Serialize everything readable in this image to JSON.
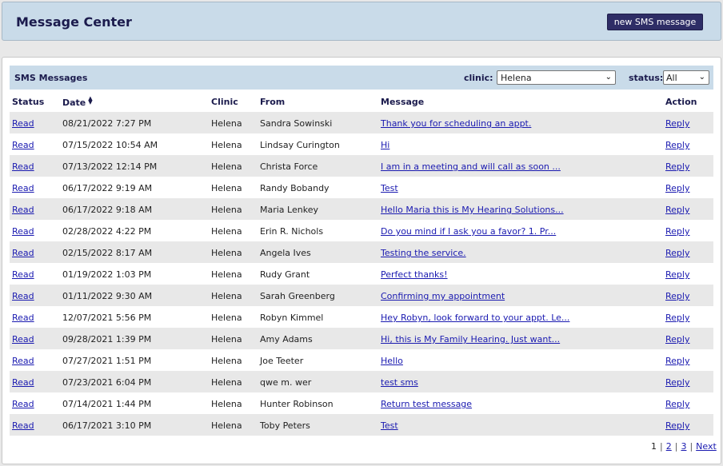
{
  "header": {
    "title": "Message Center",
    "new_button": "new SMS message"
  },
  "panel": {
    "title": "SMS Messages",
    "clinic_label": "clinic:",
    "clinic_value": "Helena",
    "status_label": "status:",
    "status_value": "All"
  },
  "columns": {
    "status": "Status",
    "date": "Date",
    "clinic": "Clinic",
    "from": "From",
    "message": "Message",
    "action": "Action"
  },
  "rows": [
    {
      "status": "Read",
      "date": "08/21/2022 7:27 PM",
      "clinic": "Helena",
      "from": "Sandra Sowinski",
      "message": "Thank you for scheduling an appt.",
      "action": "Reply"
    },
    {
      "status": "Read",
      "date": "07/15/2022 10:54 AM",
      "clinic": "Helena",
      "from": "Lindsay Curington",
      "message": "Hi",
      "action": "Reply"
    },
    {
      "status": "Read",
      "date": "07/13/2022 12:14 PM",
      "clinic": "Helena",
      "from": "Christa Force",
      "message": "I am in a meeting and will call as soon ...",
      "action": "Reply"
    },
    {
      "status": "Read",
      "date": "06/17/2022 9:19 AM",
      "clinic": "Helena",
      "from": "Randy Bobandy",
      "message": "Test",
      "action": "Reply"
    },
    {
      "status": "Read",
      "date": "06/17/2022 9:18 AM",
      "clinic": "Helena",
      "from": "Maria Lenkey",
      "message": "Hello Maria this is My Hearing Solutions...",
      "action": "Reply"
    },
    {
      "status": "Read",
      "date": "02/28/2022 4:22 PM",
      "clinic": "Helena",
      "from": "Erin R. Nichols",
      "message": "Do you mind if I ask you a favor? 1. Pr...",
      "action": "Reply"
    },
    {
      "status": "Read",
      "date": "02/15/2022 8:17 AM",
      "clinic": "Helena",
      "from": "Angela Ives",
      "message": "Testing the service.",
      "action": "Reply"
    },
    {
      "status": "Read",
      "date": "01/19/2022 1:03 PM",
      "clinic": "Helena",
      "from": "Rudy Grant",
      "message": "Perfect thanks!",
      "action": "Reply"
    },
    {
      "status": "Read",
      "date": "01/11/2022 9:30 AM",
      "clinic": "Helena",
      "from": "Sarah Greenberg",
      "message": "Confirming my appointment",
      "action": "Reply"
    },
    {
      "status": "Read",
      "date": "12/07/2021 5:56 PM",
      "clinic": "Helena",
      "from": "Robyn Kimmel",
      "message": "Hey Robyn, look forward to your appt. Le...",
      "action": "Reply"
    },
    {
      "status": "Read",
      "date": "09/28/2021 1:39 PM",
      "clinic": "Helena",
      "from": "Amy Adams",
      "message": "Hi, this is My Family Hearing. Just want...",
      "action": "Reply"
    },
    {
      "status": "Read",
      "date": "07/27/2021 1:51 PM",
      "clinic": "Helena",
      "from": "Joe Teeter",
      "message": "Hello",
      "action": "Reply"
    },
    {
      "status": "Read",
      "date": "07/23/2021 6:04 PM",
      "clinic": "Helena",
      "from": "qwe m. wer",
      "message": "test sms",
      "action": "Reply"
    },
    {
      "status": "Read",
      "date": "07/14/2021 1:44 PM",
      "clinic": "Helena",
      "from": "Hunter Robinson",
      "message": "Return test message",
      "action": "Reply"
    },
    {
      "status": "Read",
      "date": "06/17/2021 3:10 PM",
      "clinic": "Helena",
      "from": "Toby Peters",
      "message": "Test",
      "action": "Reply"
    }
  ],
  "pagination": {
    "current": "1",
    "pages": [
      "2",
      "3"
    ],
    "next": "Next"
  }
}
